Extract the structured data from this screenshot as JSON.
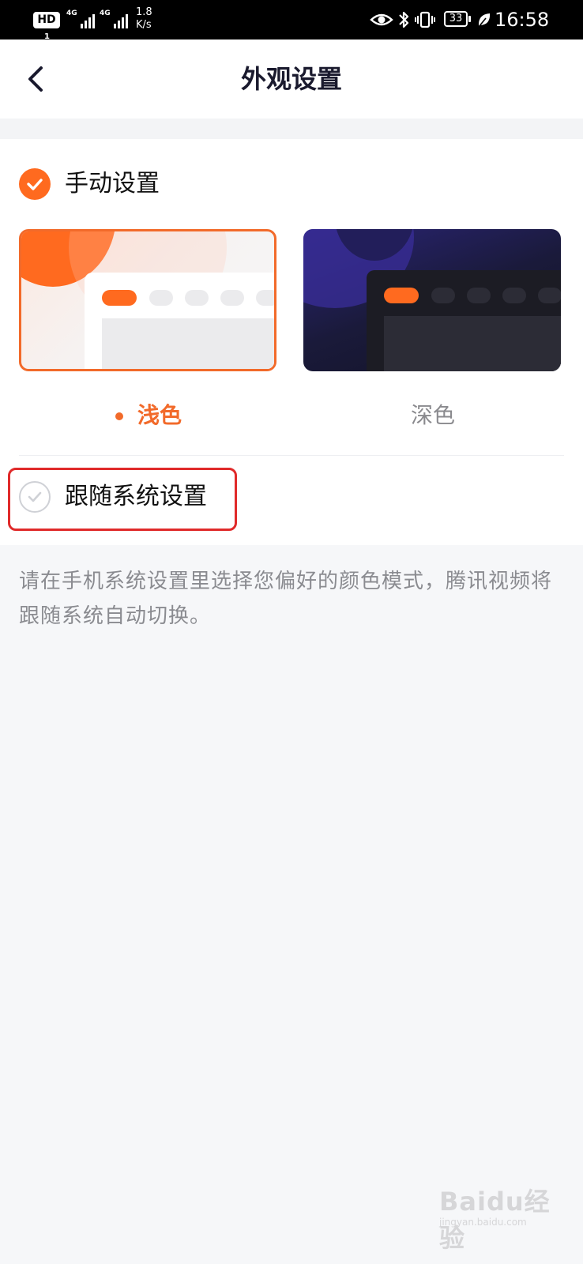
{
  "status_bar": {
    "hd_label": "HD",
    "hd_sub": "1",
    "signal1_label": "4G",
    "signal2_label": "4G",
    "speed_value": "1.8",
    "speed_unit": "K/s",
    "battery": "33",
    "time": "16:58"
  },
  "header": {
    "title": "外观设置"
  },
  "manual": {
    "label": "手动设置",
    "checked": true
  },
  "themes": [
    {
      "label": "浅色",
      "selected": true
    },
    {
      "label": "深色",
      "selected": false
    }
  ],
  "follow_system": {
    "label": "跟随系统设置",
    "checked": false
  },
  "description": "请在手机系统设置里选择您偏好的颜色模式，腾讯视频将跟随系统自动切换。",
  "colors": {
    "accent": "#ff6a1f",
    "highlight_border": "#e02a2a",
    "dark_preview_bg": "#1a1a3a",
    "page_bg": "#f6f7f9"
  },
  "watermark": {
    "logo": "Baidu经验",
    "sub": "jingyan.baidu.com"
  }
}
